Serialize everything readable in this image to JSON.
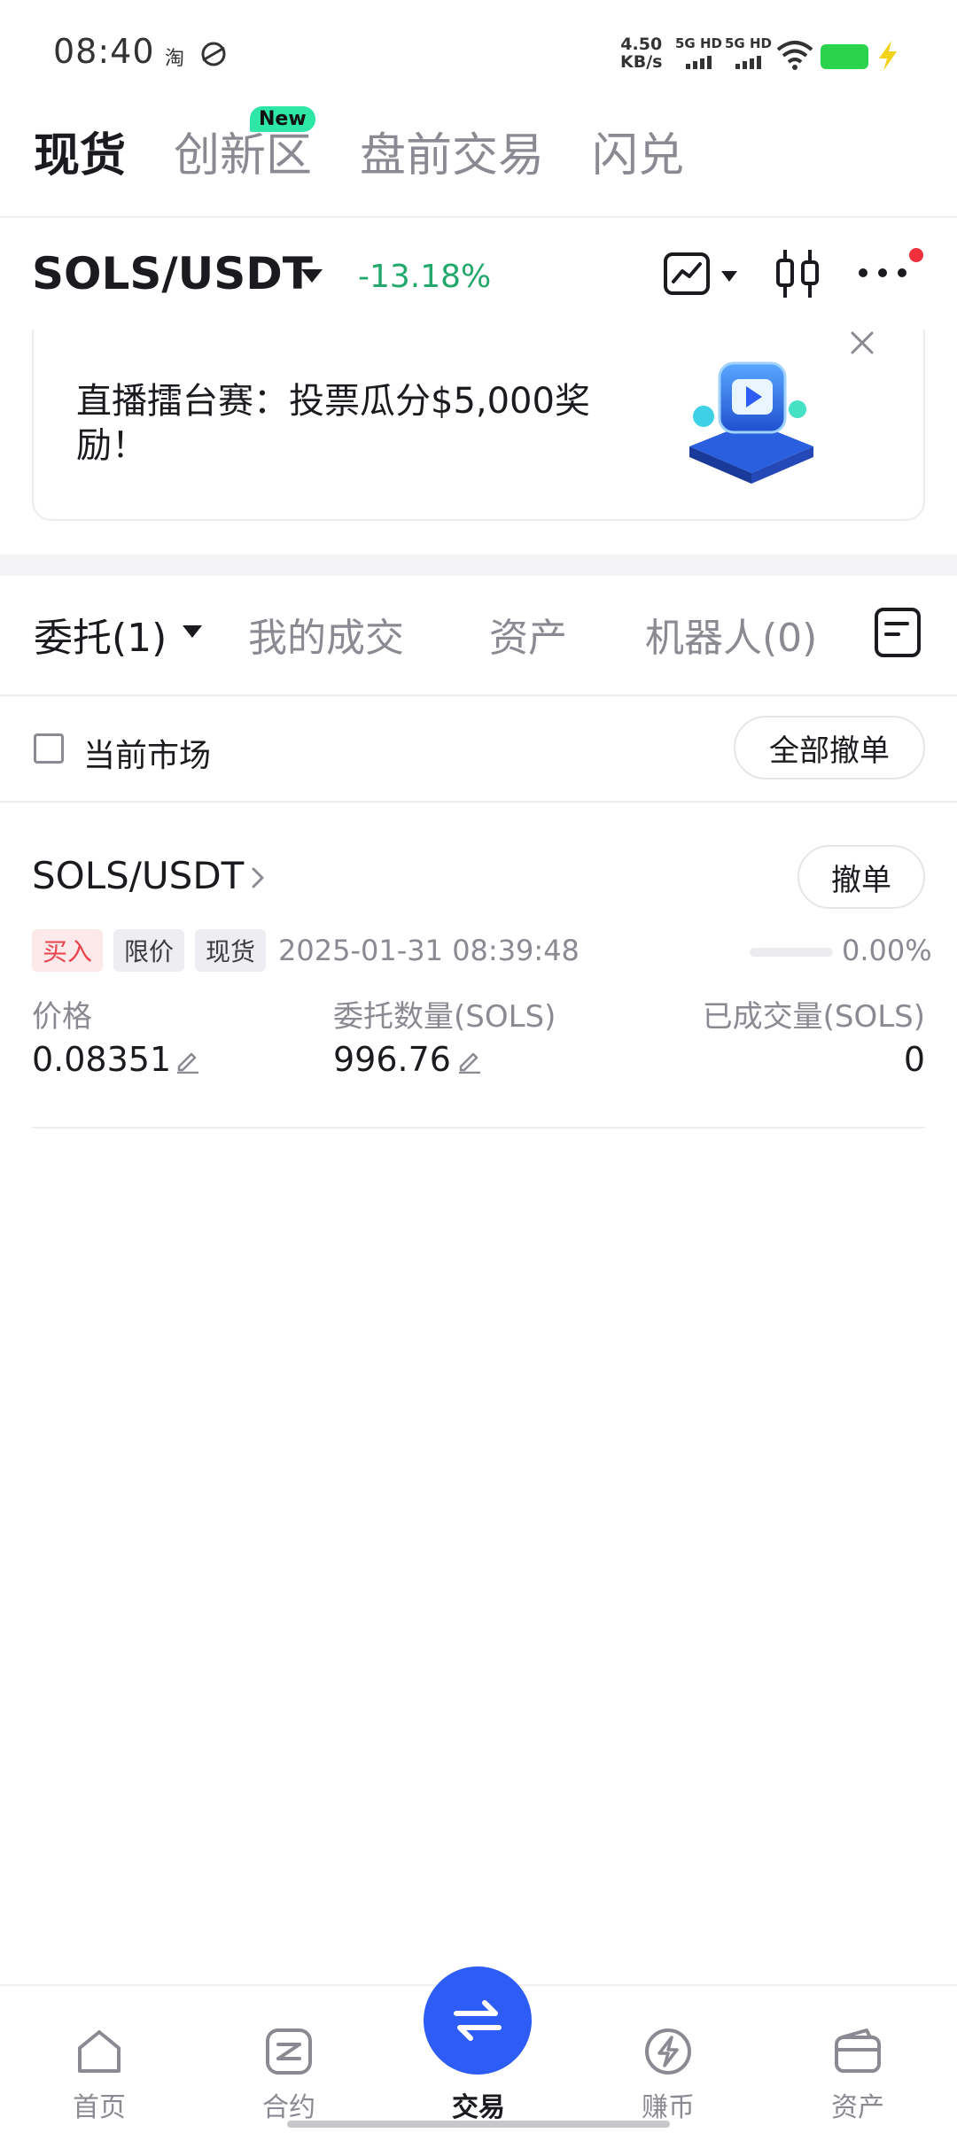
{
  "status_bar": {
    "time": "08:40",
    "app_icon_1": "淘",
    "net_speed_value": "4.50",
    "net_speed_unit": "KB/s",
    "sim1_label": "5G HD",
    "sim2_label": "5G HD",
    "battery_color": "#2ad34b"
  },
  "top_tabs": [
    {
      "label": "现货",
      "active": true
    },
    {
      "label": "创新区",
      "active": false
    },
    {
      "label": "盘前交易",
      "active": false
    },
    {
      "label": "闪兑",
      "active": false
    }
  ],
  "new_badge": "New",
  "pair_header": {
    "pair": "SOLS/USDT",
    "change": "-13.18%",
    "change_color": "#22a86b",
    "icons": [
      "chart-line-icon",
      "candlestick-icon",
      "more-icon"
    ]
  },
  "banner": {
    "text": "直播擂台赛：投票瓜分$5,000奖励！"
  },
  "section_tabs": [
    {
      "label": "委托(1)",
      "active": true
    },
    {
      "label": "我的成交",
      "active": false
    },
    {
      "label": "资产",
      "active": false
    },
    {
      "label": "机器人(0)",
      "active": false
    }
  ],
  "filter": {
    "checkbox_label": "当前市场",
    "checked": false,
    "cancel_all_label": "全部撤单"
  },
  "order": {
    "pair": "SOLS/USDT",
    "cancel_label": "撤单",
    "tags": [
      "买入",
      "限价",
      "现货"
    ],
    "time": "2025-01-31 08:39:48",
    "progress": 0.0,
    "progress_text": "0.00%",
    "price_label": "价格",
    "price_value": "0.08351",
    "amount_label": "委托数量(SOLS)",
    "amount_value": "996.76",
    "filled_label": "已成交量(SOLS)",
    "filled_value": "0"
  },
  "bottom_nav": [
    {
      "label": "首页",
      "icon": "home-icon",
      "active": false
    },
    {
      "label": "合约",
      "icon": "contract-icon",
      "active": false
    },
    {
      "label": "交易",
      "icon": "swap-arrows-icon",
      "active": true
    },
    {
      "label": "赚币",
      "icon": "earn-icon",
      "active": false
    },
    {
      "label": "资产",
      "icon": "wallet-icon",
      "active": false
    }
  ],
  "accent_color": "#2d5cf6"
}
